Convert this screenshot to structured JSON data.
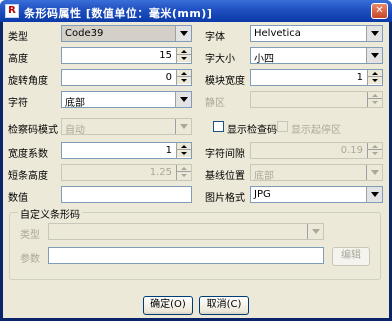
{
  "window": {
    "title": "条形码属性 [数值单位：毫米(mm)]",
    "icon_letter": "R",
    "close_glyph": "✕"
  },
  "form": {
    "type_label": "类型",
    "type_value": "Code39",
    "font_label": "字体",
    "font_value": "Helvetica",
    "height_label": "高度",
    "height_value": "15",
    "font_size_label": "字大小",
    "font_size_value": "小四",
    "rotation_label": "旋转角度",
    "rotation_value": "0",
    "module_width_label": "模块宽度",
    "module_width_value": "1",
    "text_label": "字符",
    "text_value": "底部",
    "quiet_zone_label": "静区",
    "quiet_zone_value": "",
    "check_mode_label": "检察码模式",
    "check_mode_value": "自动",
    "show_check_label": "显示检查码",
    "show_startstop_label": "显示起停区",
    "width_factor_label": "宽度系数",
    "width_factor_value": "1",
    "char_spacing_label": "字符间隙",
    "char_spacing_value": "0.19",
    "short_bar_label": "短条高度",
    "short_bar_value": "1.25",
    "baseline_label": "基线位置",
    "baseline_value": "底部",
    "value_label": "数值",
    "value_value": "",
    "image_format_label": "图片格式",
    "image_format_value": "JPG"
  },
  "custom_group": {
    "title": "自定义条形码",
    "type_label": "类型",
    "type_value": "",
    "param_label": "参数",
    "param_value": "",
    "edit_button": "编辑"
  },
  "buttons": {
    "ok": "确定(O)",
    "cancel": "取消(C)"
  },
  "colors": {
    "titlebar": "#1f4fc0",
    "client": "#ece9d8",
    "input_border": "#7f9db9"
  }
}
